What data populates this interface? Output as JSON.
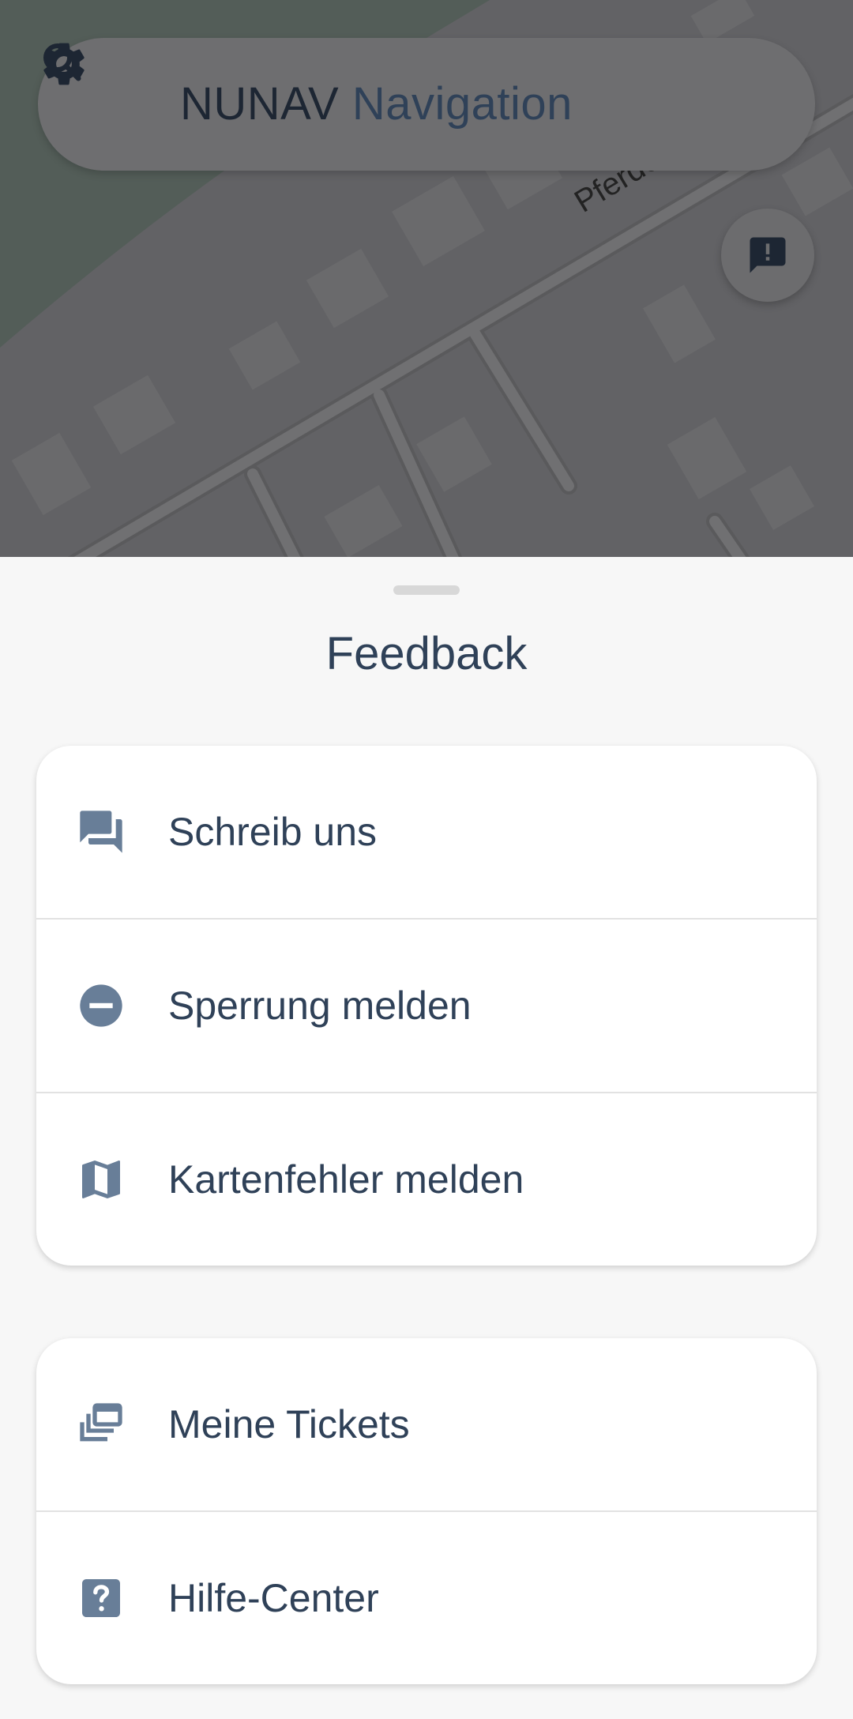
{
  "search": {
    "brand": "NUNAV",
    "product": "Navigation"
  },
  "map": {
    "street_label": "Pferdek"
  },
  "sheet": {
    "title": "Feedback"
  },
  "feedback_items": [
    {
      "label": "Schreib uns",
      "icon": "forum-icon"
    },
    {
      "label": "Sperrung melden",
      "icon": "do-not-enter-icon"
    },
    {
      "label": "Kartenfehler melden",
      "icon": "map-icon"
    }
  ],
  "support_items": [
    {
      "label": "Meine Tickets",
      "icon": "tickets-icon"
    },
    {
      "label": "Hilfe-Center",
      "icon": "help-icon"
    }
  ],
  "colors": {
    "accent": "#2f4158",
    "icon": "#687e98",
    "map_dim": "#626265"
  }
}
